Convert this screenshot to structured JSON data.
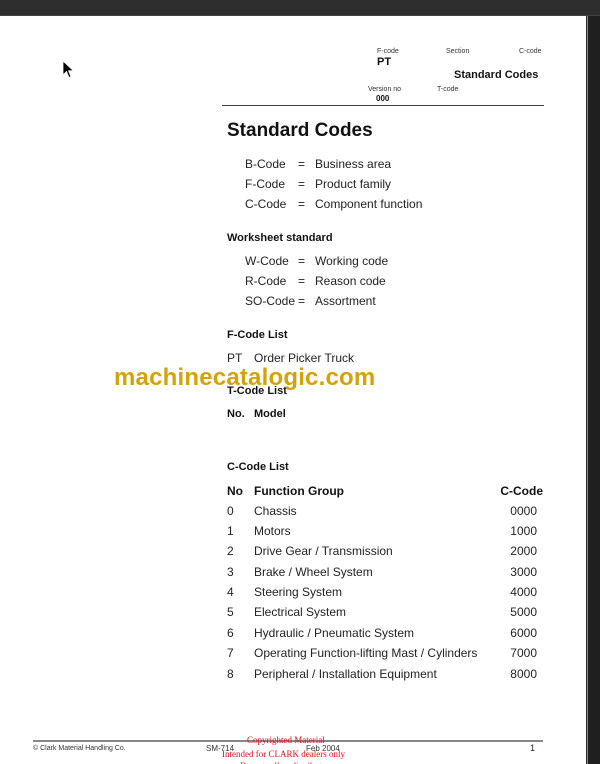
{
  "header": {
    "fcode_label": "F-code",
    "fcode_value": "PT",
    "section_label": "Section",
    "ccode_label": "C-code",
    "section_value": "Standard Codes",
    "version_label": "Version no",
    "version_value": "000",
    "tcode_label": "T-code"
  },
  "title": "Standard Codes",
  "code_definitions": [
    {
      "code": "B-Code",
      "eq": "=",
      "meaning": "Business area"
    },
    {
      "code": "F-Code",
      "eq": "=",
      "meaning": "Product family"
    },
    {
      "code": "C-Code",
      "eq": "=",
      "meaning": "Component function"
    }
  ],
  "worksheet": {
    "heading": "Worksheet standard",
    "items": [
      {
        "code": "W-Code",
        "eq": "=",
        "meaning": "Working code"
      },
      {
        "code": "R-Code",
        "eq": "=",
        "meaning": "Reason code"
      },
      {
        "code": "SO-Code",
        "eq": "=",
        "meaning": "Assortment"
      }
    ]
  },
  "fcode_list": {
    "heading": "F-Code List",
    "code": "PT",
    "name": "Order Picker Truck"
  },
  "watermark": "machinecatalogic.com",
  "tcode_list": {
    "heading": "T-Code List",
    "col_no": "No.",
    "col_model": "Model"
  },
  "ccode_list": {
    "heading": "C-Code List",
    "col_no": "No",
    "col_group": "Function Group",
    "col_code": "C-Code",
    "rows": [
      {
        "no": "0",
        "group": "Chassis",
        "code": "0000"
      },
      {
        "no": "1",
        "group": "Motors",
        "code": "1000"
      },
      {
        "no": "2",
        "group": "Drive Gear / Transmission",
        "code": "2000"
      },
      {
        "no": "3",
        "group": "Brake / Wheel System",
        "code": "3000"
      },
      {
        "no": "4",
        "group": "Steering System",
        "code": "4000"
      },
      {
        "no": "5",
        "group": "Electrical System",
        "code": "5000"
      },
      {
        "no": "6",
        "group": "Hydraulic / Pneumatic System",
        "code": "6000"
      },
      {
        "no": "7",
        "group": "Operating Function-lifting Mast / Cylinders",
        "code": "7000"
      },
      {
        "no": "8",
        "group": "Peripheral / Installation Equipment",
        "code": "8000"
      }
    ]
  },
  "footer": {
    "copyright": "© Clark Material Handling Co.",
    "doc_no": "SM-714",
    "date": "Feb 2004",
    "page": "1",
    "notice_line1": "Copyrighted Material",
    "notice_line2": "Intended for CLARK dealers only",
    "notice_line3": "Do not sell or distribute"
  }
}
